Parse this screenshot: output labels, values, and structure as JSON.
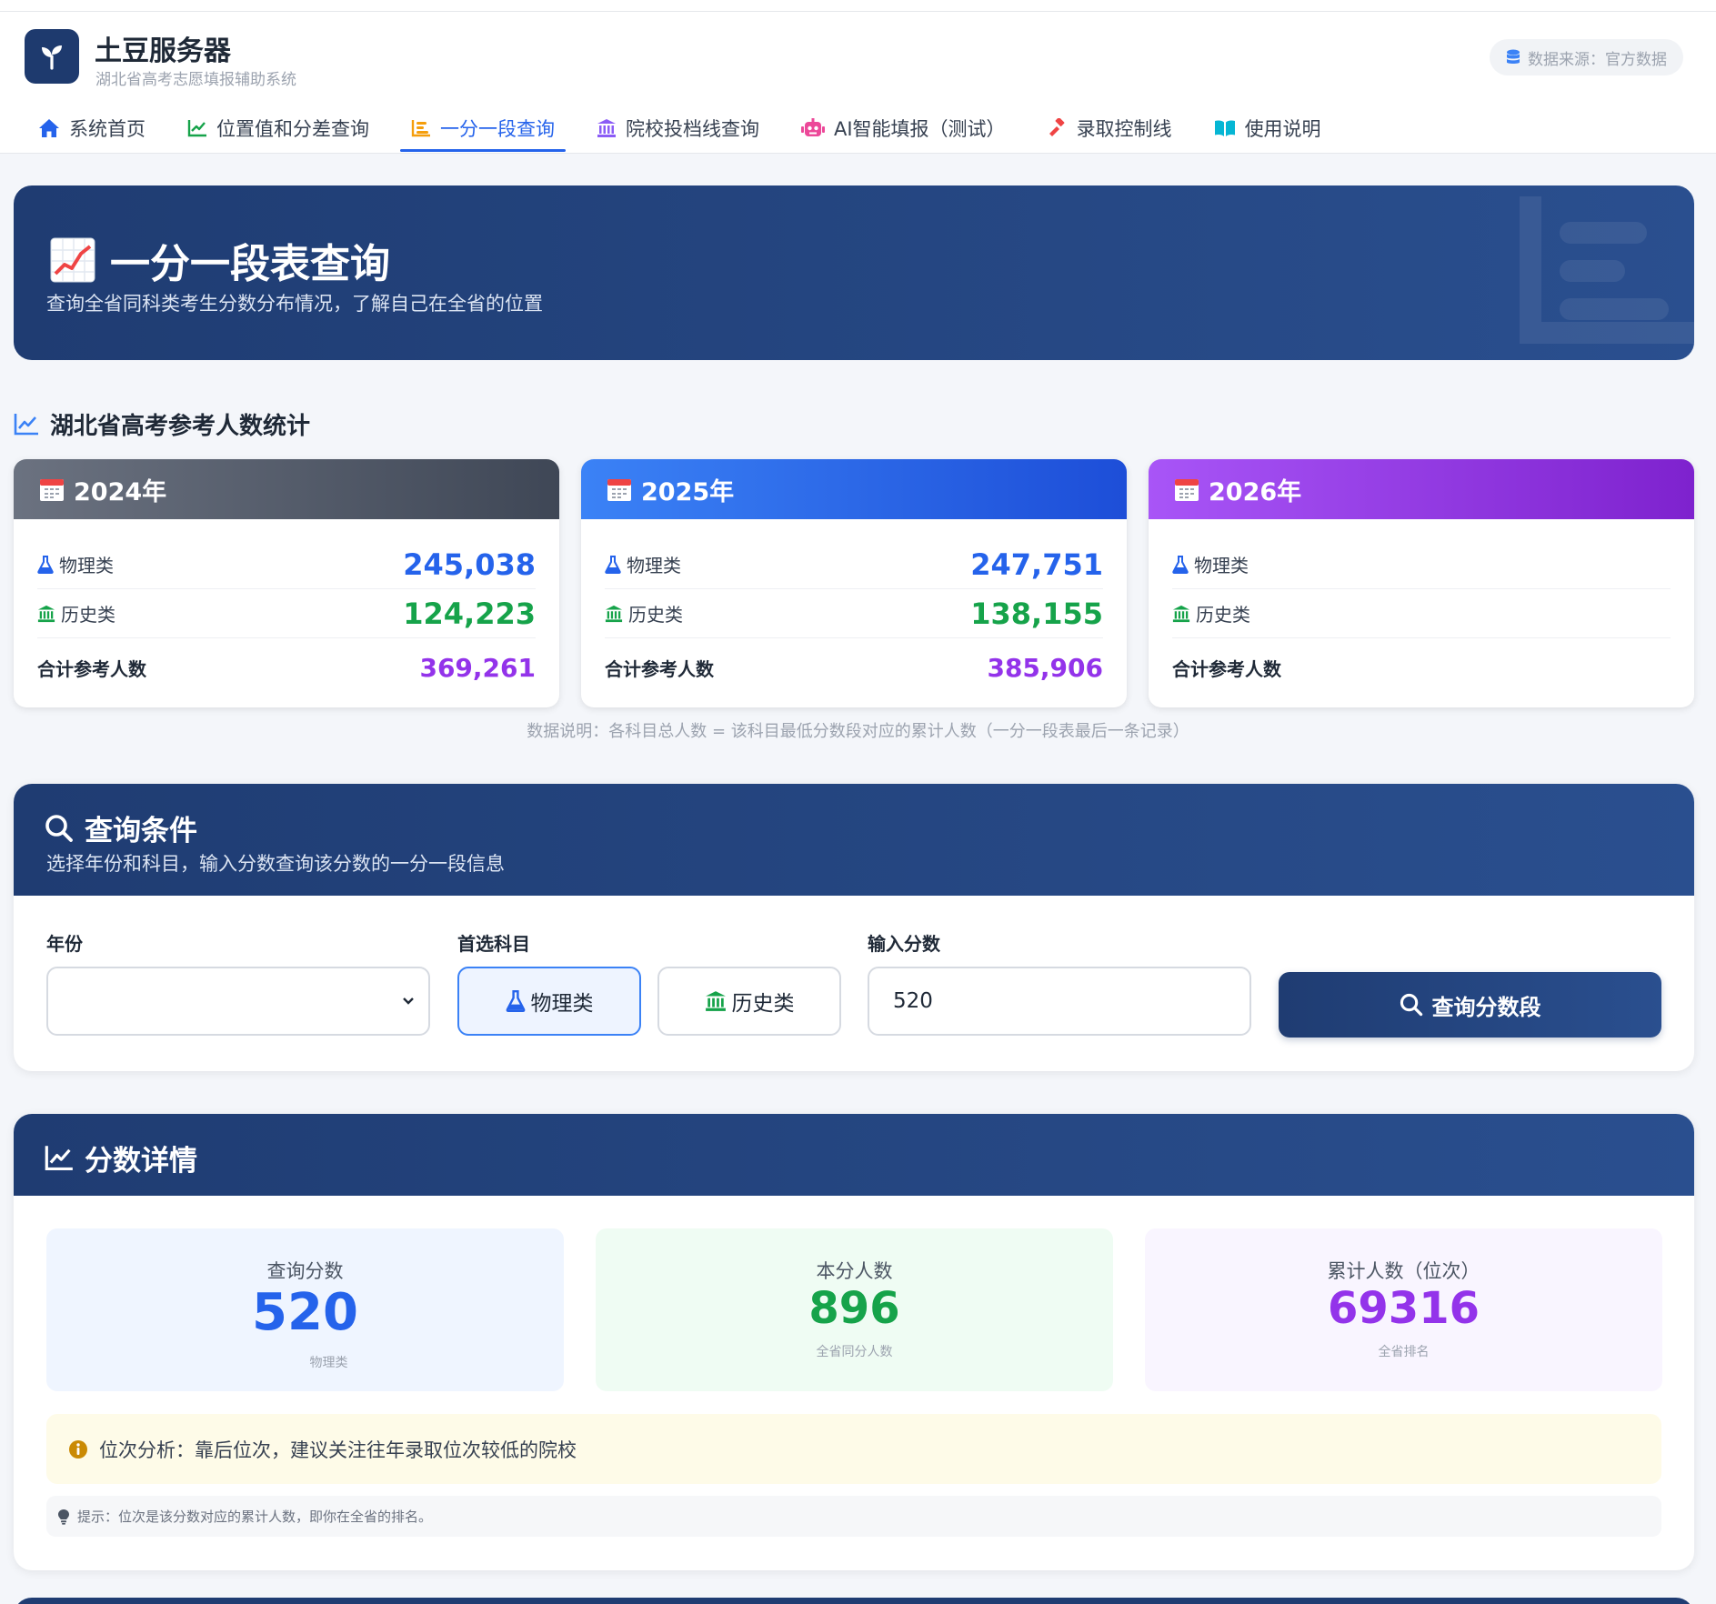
{
  "app": {
    "title": "土豆服务器",
    "subtitle": "湖北省高考志愿填报辅助系统",
    "data_source": "数据来源：官方数据"
  },
  "nav": [
    {
      "label": "系统首页",
      "icon": "home-icon"
    },
    {
      "label": "位置值和分差查询",
      "icon": "line-chart-icon"
    },
    {
      "label": "一分一段查询",
      "icon": "bar-list-icon",
      "active": true
    },
    {
      "label": "院校投档线查询",
      "icon": "bank-icon"
    },
    {
      "label": "AI智能填报（测试）",
      "icon": "robot-icon"
    },
    {
      "label": "录取控制线",
      "icon": "gavel-icon"
    },
    {
      "label": "使用说明",
      "icon": "book-icon"
    }
  ],
  "hero": {
    "title": "一分一段表查询",
    "subtitle": "查询全省同科类考生分数分布情况，了解自己在全省的位置"
  },
  "stats": {
    "title": "湖北省高考参考人数统计",
    "physics_label": "物理类",
    "history_label": "历史类",
    "total_label": "合计参考人数",
    "years": [
      {
        "year": "2024年",
        "physics": "245,038",
        "history": "124,223",
        "total": "369,261"
      },
      {
        "year": "2025年",
        "physics": "247,751",
        "history": "138,155",
        "total": "385,906"
      },
      {
        "year": "2026年",
        "physics": "",
        "history": "",
        "total": ""
      }
    ],
    "note": "数据说明：各科目总人数 = 该科目最低分数段对应的累计人数（一分一段表最后一条记录）"
  },
  "query": {
    "title": "查询条件",
    "subtitle": "选择年份和科目，输入分数查询该分数的一分一段信息",
    "year_label": "年份",
    "year_value": "",
    "subject_label": "首选科目",
    "subject_physics": "物理类",
    "subject_history": "历史类",
    "score_label": "输入分数",
    "score_value": "520",
    "button": "查询分数段"
  },
  "detail": {
    "title": "分数详情",
    "score_label": "查询分数",
    "score_value": "520",
    "score_hint": "物理类",
    "count_label": "本分人数",
    "count_value": "896",
    "count_hint": "全省同分人数",
    "rank_label": "累计人数（位次）",
    "rank_value": "69316",
    "rank_hint": "全省排名",
    "analysis": "位次分析：靠后位次，建议关注往年录取位次较低的院校",
    "tip": "提示：位次是该分数对应的累计人数，即你在全省的排名。"
  },
  "colors": {
    "primary": "#1f3c72",
    "blue": "#2563eb",
    "green": "#16a34a",
    "purple": "#9333ea",
    "year_2024": "#4b5563",
    "year_2025": "#2563eb",
    "year_2026": "#9333ea"
  }
}
